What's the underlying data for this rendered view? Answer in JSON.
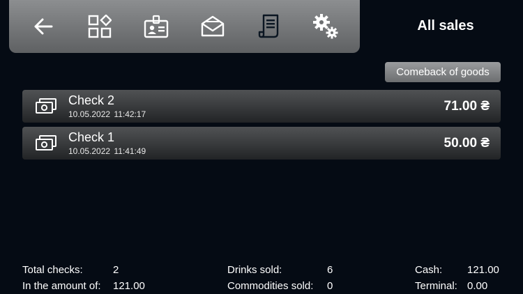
{
  "toolbar": {
    "items": [
      {
        "name": "back-arrow-icon"
      },
      {
        "name": "categories-icon"
      },
      {
        "name": "id-badge-icon"
      },
      {
        "name": "envelope-icon"
      },
      {
        "name": "receipt-icon"
      },
      {
        "name": "settings-gears-icon"
      }
    ]
  },
  "header": {
    "title": "All sales"
  },
  "actions": {
    "comeback_label": "Comeback of goods"
  },
  "checks": [
    {
      "title": "Check 2",
      "date": "10.05.2022",
      "time": "11:42:17",
      "amount": "71.00 ₴"
    },
    {
      "title": "Check 1",
      "date": "10.05.2022",
      "time": "11:41:49",
      "amount": "50.00 ₴"
    }
  ],
  "summary": {
    "total_checks_label": "Total checks:",
    "total_checks_value": "2",
    "amount_label": "In the amount of:",
    "amount_value": "121.00",
    "drinks_label": "Drinks sold:",
    "drinks_value": "6",
    "commodities_label": "Commodities sold:",
    "commodities_value": "0",
    "cash_label": "Cash:",
    "cash_value": "121.00",
    "terminal_label": "Terminal:",
    "terminal_value": "0.00"
  },
  "colors": {
    "background": "#050b14",
    "toolbar_top": "#8c8e90",
    "toolbar_bottom": "#5f6163",
    "active_icon": "#0b1622",
    "row_top": "#505254",
    "row_bottom": "#222426"
  }
}
